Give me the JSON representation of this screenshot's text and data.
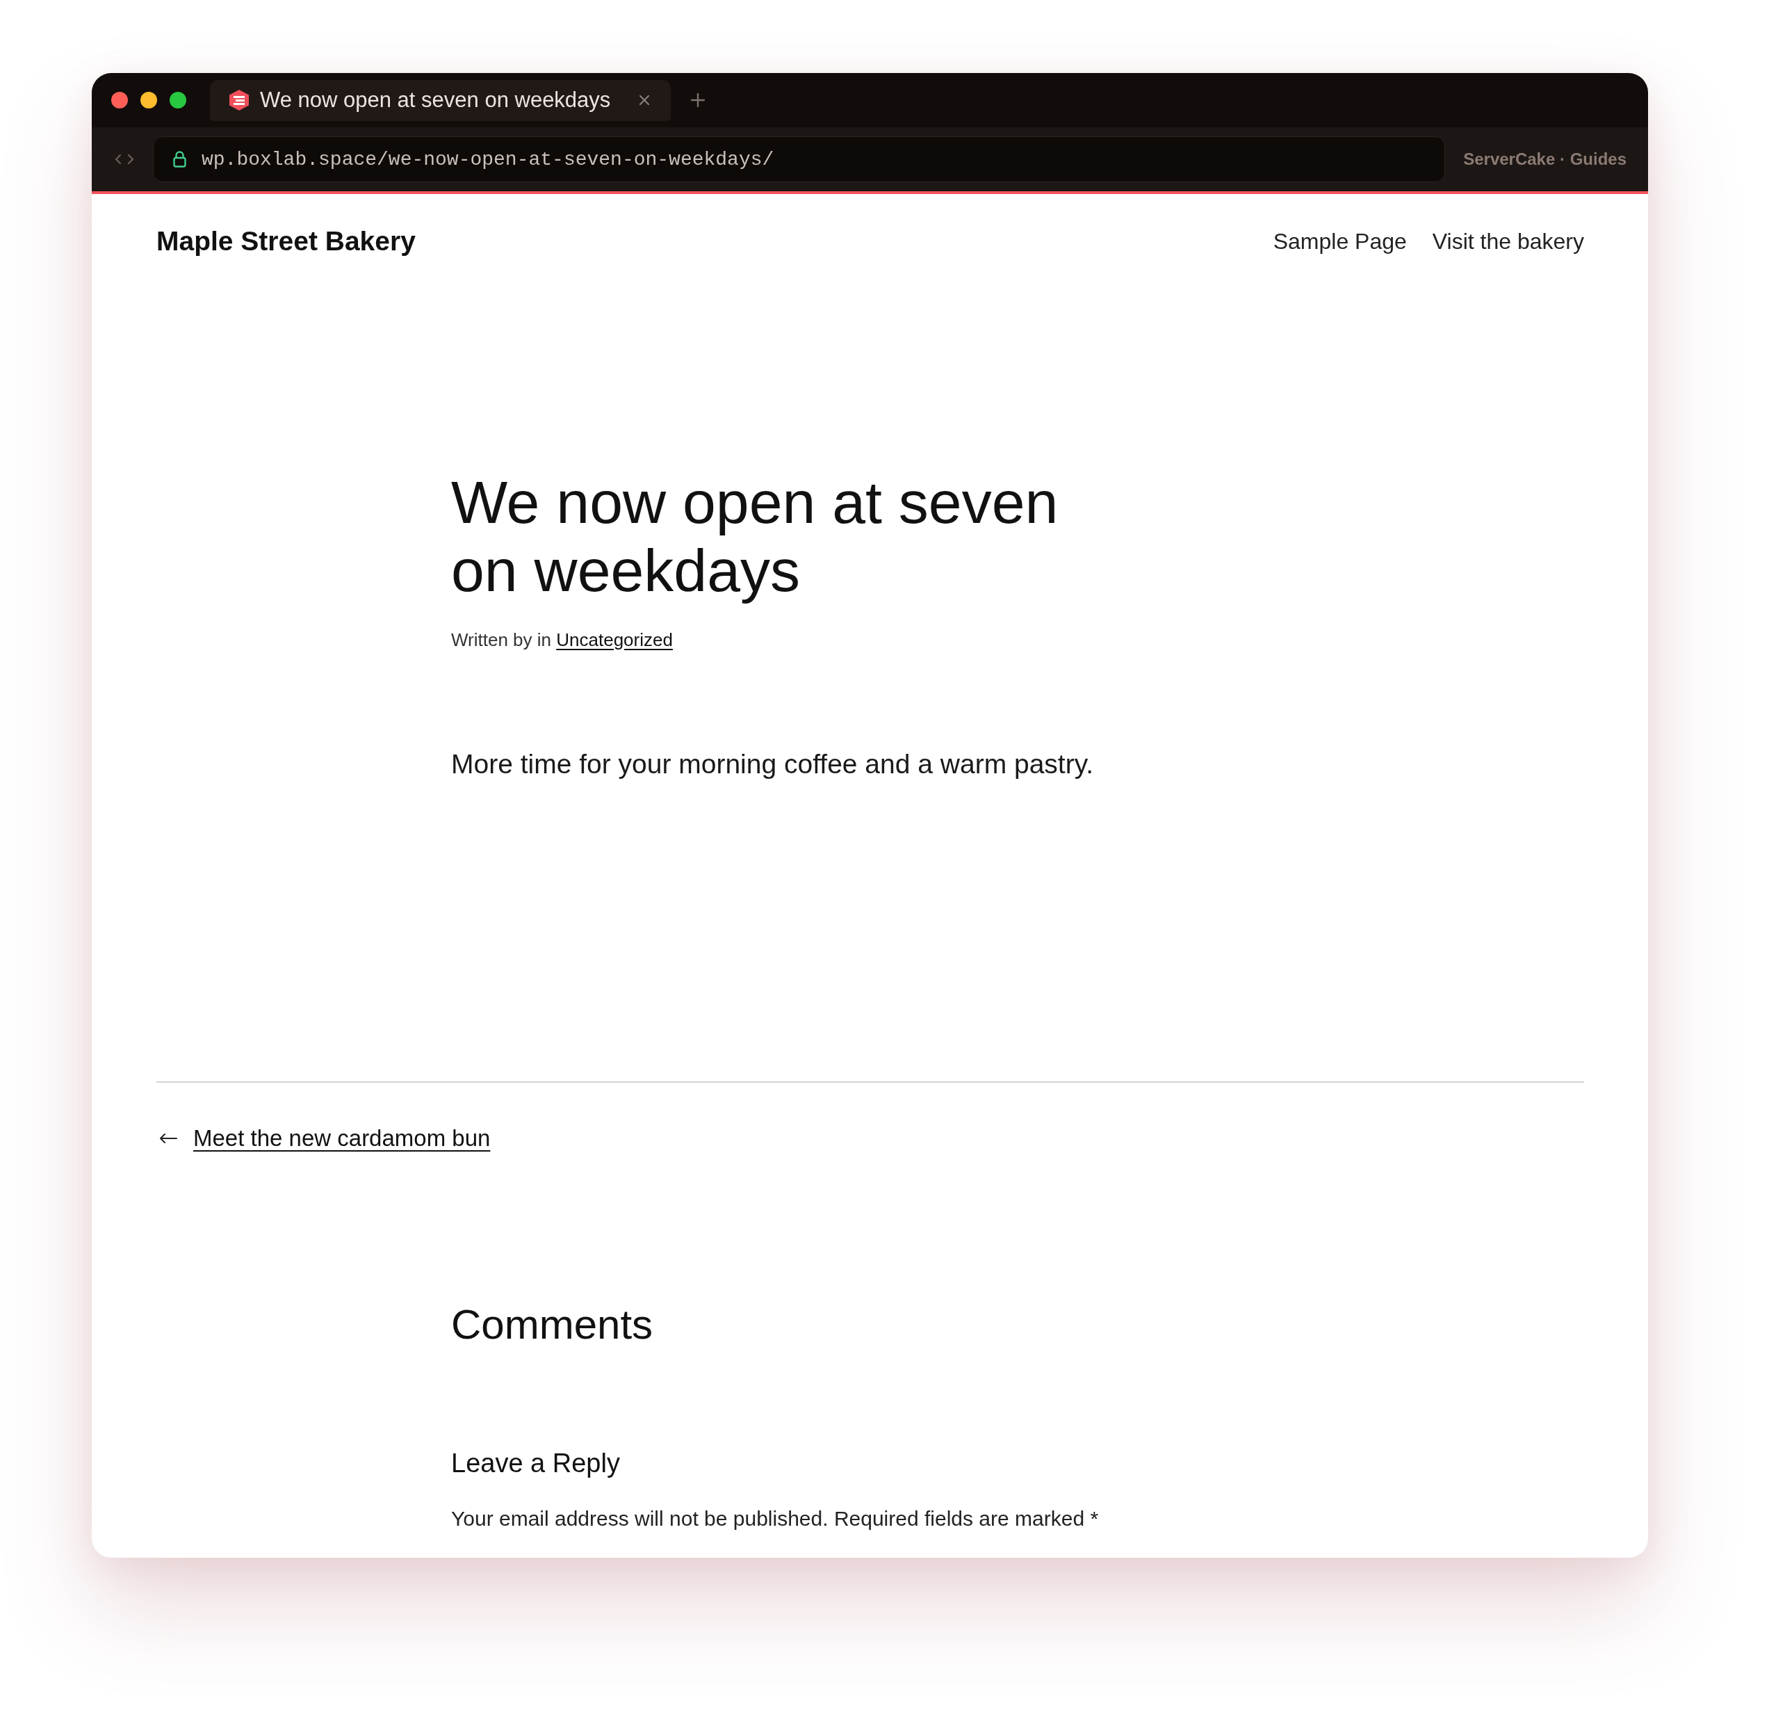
{
  "browser": {
    "tabs": [
      {
        "title": "We now open at seven on weekdays",
        "selected": true
      }
    ],
    "url": "wp.boxlab.space/we-now-open-at-seven-on-weekdays/",
    "toolbar_label": "ServerCake · Guides"
  },
  "site": {
    "title": "Maple Street Bakery",
    "nav": [
      {
        "label": "Sample Page"
      },
      {
        "label": "Visit the bakery"
      }
    ]
  },
  "post": {
    "title": "We now open at seven on weekdays",
    "meta": "Written by in",
    "category": "Uncategorized",
    "body": "More time for your morning coffee and a warm pastry."
  },
  "post_navigation": {
    "previous": "Meet the new cardamom bun"
  },
  "comments": {
    "heading": "Comments",
    "reply_title": "Leave a Reply",
    "notes": "Your email address will not be published. Required fields are marked *"
  }
}
